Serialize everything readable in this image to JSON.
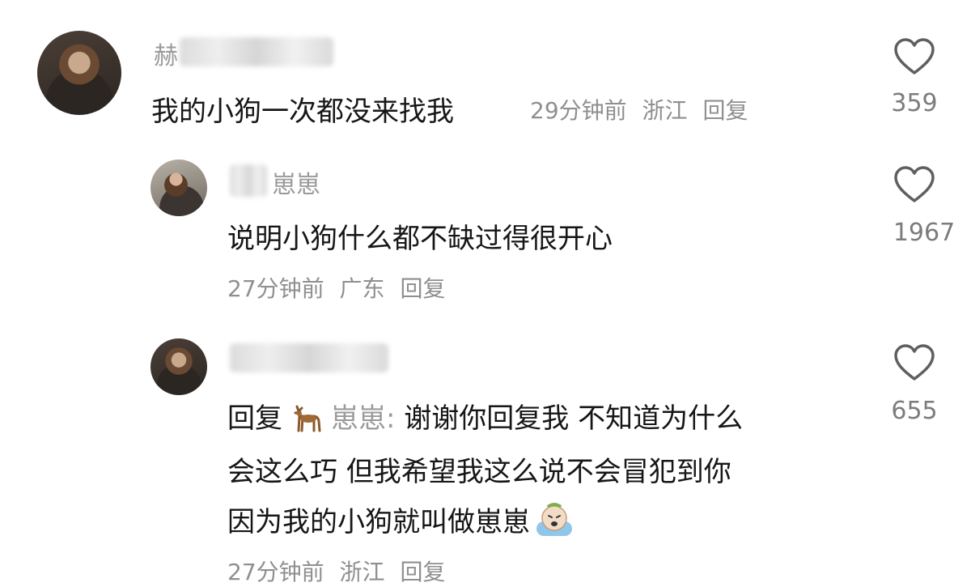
{
  "comments": [
    {
      "username_visible": "赫",
      "text": "我的小狗一次都没来找我",
      "time": "29分钟前",
      "location": "浙江",
      "reply_label": "回复",
      "likes": "359"
    },
    {
      "username_visible": "崽崽",
      "text": "说明小狗什么都不缺过得很开心",
      "time": "27分钟前",
      "location": "广东",
      "reply_label": "回复",
      "likes": "1967"
    },
    {
      "reply_prefix": "回复",
      "reply_to": "崽崽:",
      "text_line1": "谢谢你回复我 不知道为什么",
      "text_line2": "会这么巧 但我希望我这么说不会冒犯到你",
      "text_line3": "因为我的小狗就叫做崽崽",
      "time": "27分钟前",
      "location": "浙江",
      "reply_label": "回复",
      "likes": "655"
    }
  ],
  "icons": {
    "like": "heart-outline-icon",
    "deer": "deer-emoji-icon",
    "cry": "crying-emoji-icon"
  },
  "colors": {
    "text": "#161616",
    "meta": "#8f8f8f",
    "like": "#5f5f5f"
  }
}
